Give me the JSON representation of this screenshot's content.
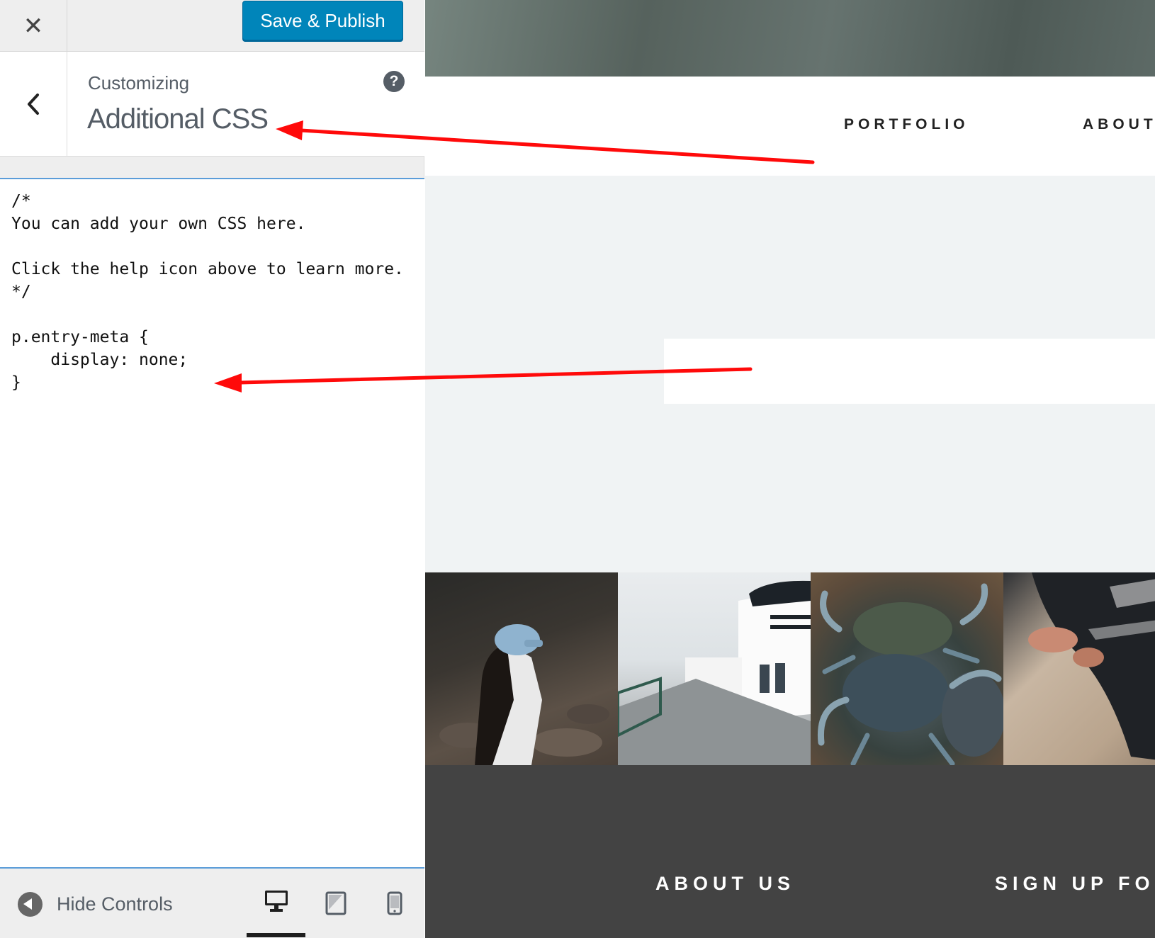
{
  "topbar": {
    "close_icon": "close-icon",
    "save_label": "Save & Publish"
  },
  "section": {
    "back_icon": "chevron-left-icon",
    "breadcrumb": "Customizing",
    "title": "Additional CSS",
    "help_icon": "help-icon",
    "help_glyph": "?"
  },
  "editor": {
    "value": "/*\nYou can add your own CSS here.\n\nClick the help icon above to learn more.\n*/\n\np.entry-meta {\n    display: none;\n}"
  },
  "footer": {
    "hide_label": "Hide Controls",
    "devices": [
      "desktop",
      "tablet",
      "mobile"
    ],
    "active_device": "desktop"
  },
  "preview": {
    "nav": [
      "PORTFOLIO",
      "ABOUT"
    ],
    "footer_headings": [
      "ABOUT US",
      "SIGN UP FOR"
    ]
  },
  "colors": {
    "primary_button": "#0085ba",
    "annotation_arrow": "#ff0000",
    "preview_footer": "#434343"
  }
}
